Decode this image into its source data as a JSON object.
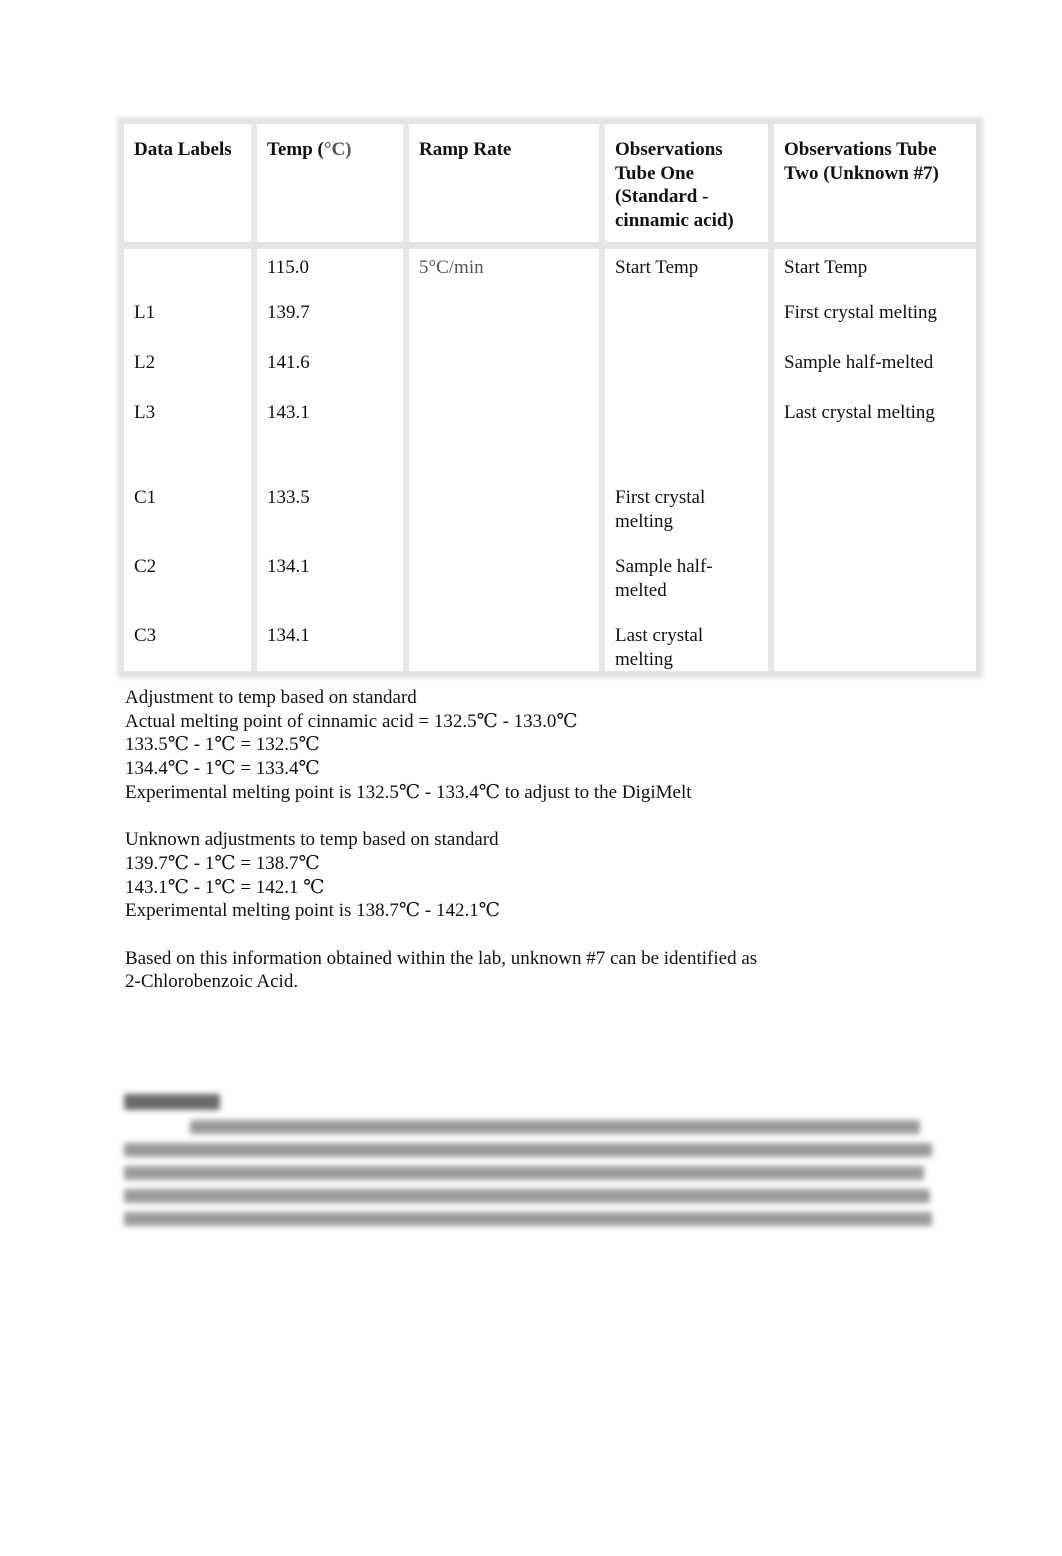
{
  "table": {
    "headers": {
      "labels": "Data Labels",
      "temp_prefix": "Temp (",
      "temp_unit": "°C)",
      "ramp": "Ramp Rate",
      "tube_one": "Observations Tube One (Standard - cinnamic acid)",
      "tube_two": "Observations Tube Two (Unknown #7)"
    },
    "start_row": {
      "label": "",
      "temp": "115.0",
      "ramp": "5°C/min",
      "tube_one": "Start Temp",
      "tube_two": "Start Temp"
    },
    "unknown_rows": [
      {
        "label": "L1",
        "temp": "139.7",
        "tube_one": "",
        "tube_two": "First crystal melting"
      },
      {
        "label": "L2",
        "temp": "141.6",
        "tube_one": "",
        "tube_two": "Sample half-melted"
      },
      {
        "label": "L3",
        "temp": "143.1",
        "tube_one": "",
        "tube_two": "Last crystal melting"
      }
    ],
    "standard_rows": [
      {
        "label": "C1",
        "temp": "133.5",
        "tube_one": "First crystal melting",
        "tube_two": ""
      },
      {
        "label": "C2",
        "temp": "134.1",
        "tube_one": "Sample half-melted",
        "tube_two": ""
      },
      {
        "label": "C3",
        "temp": "134.1",
        "tube_one": "Last crystal melting",
        "tube_two": ""
      }
    ]
  },
  "notes": {
    "standard": [
      "Adjustment to temp based on standard",
      "Actual melting point of cinnamic acid = 132.5℃ - 133.0℃",
      "133.5℃  - 1℃ = 132.5℃",
      "134.4℃  - 1℃ = 133.4℃",
      "Experimental melting point is 132.5℃ - 133.4℃  to adjust to the DigiMelt"
    ],
    "unknown": [
      "Unknown adjustments to temp based on standard",
      "139.7℃ - 1℃ = 138.7℃",
      "143.1℃ - 1℃ = 142.1 ℃",
      "Experimental melting point is 138.7℃ - 142.1℃"
    ],
    "conclusion": [
      "Based on this information obtained within the lab, unknown #7 can be identified as",
      "2-Chlorobenzoic Acid."
    ]
  }
}
